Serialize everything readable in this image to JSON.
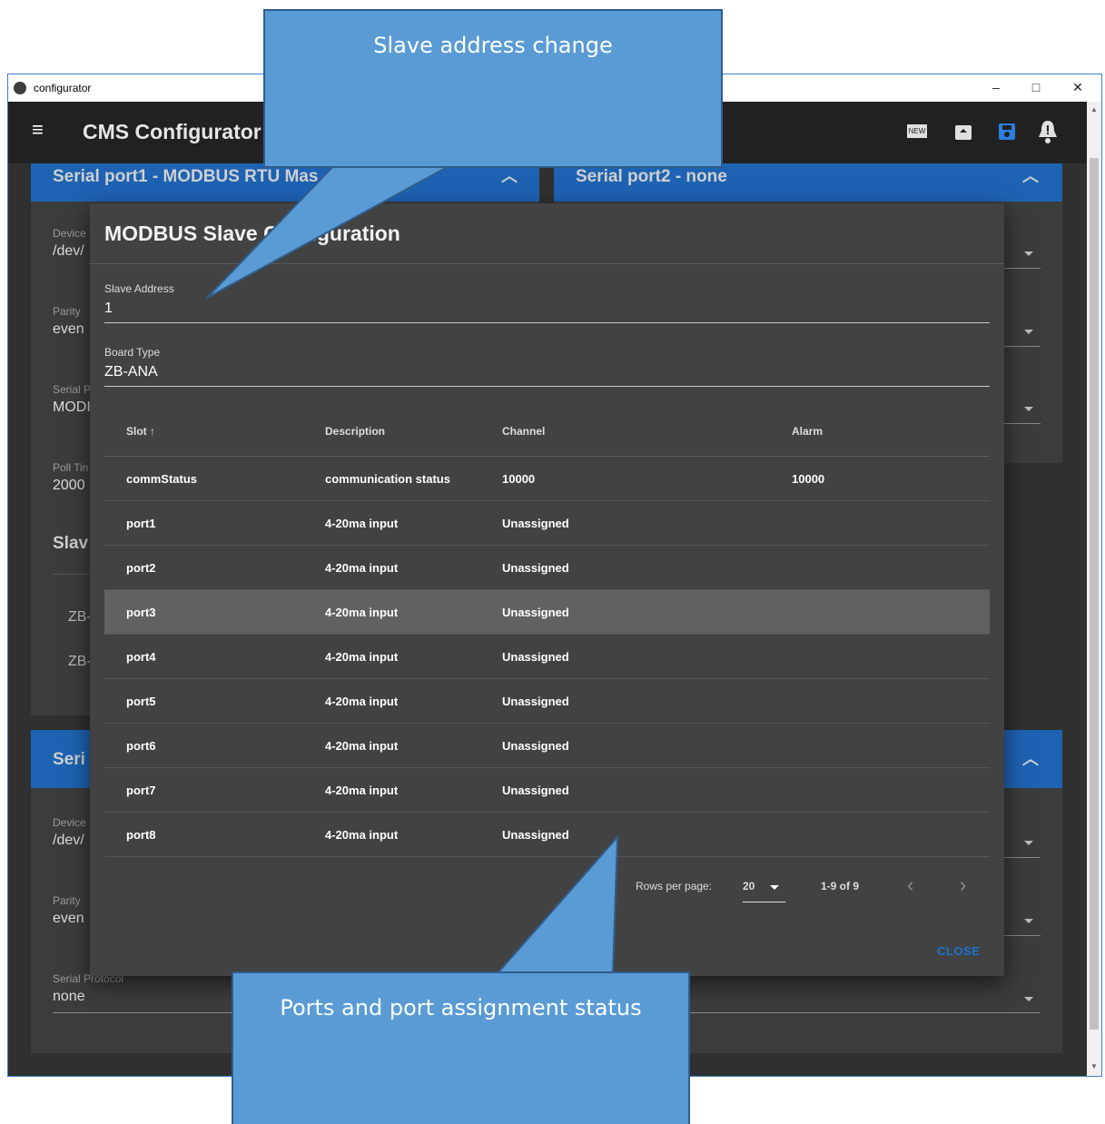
{
  "window": {
    "title": "configurator",
    "controls": {
      "minimize": "–",
      "maximize": "□",
      "close": "✕"
    }
  },
  "appbar": {
    "menu_icon": "≡",
    "title": "CMS Configurator",
    "actions": [
      {
        "icon": "new-icon",
        "label": "NEW"
      },
      {
        "icon": "archive-icon"
      },
      {
        "icon": "save-icon"
      },
      {
        "icon": "bell-alert-icon"
      }
    ]
  },
  "background": {
    "port1_header": "Serial port1 - MODBUS RTU Mas",
    "port2_header": "Serial port2 - none",
    "port1_fields": [
      {
        "label": "Device",
        "value": "/dev/"
      },
      {
        "label": "Parity",
        "value": "even"
      },
      {
        "label": "Serial P",
        "value": "MODI"
      },
      {
        "label": "Poll Tin",
        "value": "2000"
      }
    ],
    "slaves_heading": "Slav",
    "slave_items": [
      "ZB-",
      "ZB-"
    ],
    "port3_header": "Seri",
    "port3_fields": [
      {
        "label": "Device",
        "value": "/dev/"
      },
      {
        "label": "Parity",
        "value": "even"
      },
      {
        "label": "Serial Protocol",
        "value": "none"
      }
    ]
  },
  "dialog": {
    "title": "MODBUS Slave Configuration",
    "slave_address": {
      "label": "Slave Address",
      "value": "1"
    },
    "board_type": {
      "label": "Board Type",
      "value": "ZB-ANA"
    },
    "table": {
      "headers": [
        "Slot ↑",
        "Description",
        "Channel",
        "Alarm"
      ],
      "rows": [
        [
          "commStatus",
          "communication status",
          "10000",
          "10000"
        ],
        [
          "port1",
          "4-20ma input",
          "Unassigned",
          ""
        ],
        [
          "port2",
          "4-20ma input",
          "Unassigned",
          ""
        ],
        [
          "port3",
          "4-20ma input",
          "Unassigned",
          ""
        ],
        [
          "port4",
          "4-20ma input",
          "Unassigned",
          ""
        ],
        [
          "port5",
          "4-20ma input",
          "Unassigned",
          ""
        ],
        [
          "port6",
          "4-20ma input",
          "Unassigned",
          ""
        ],
        [
          "port7",
          "4-20ma input",
          "Unassigned",
          ""
        ],
        [
          "port8",
          "4-20ma input",
          "Unassigned",
          ""
        ]
      ],
      "selected_row": 3
    },
    "pagination": {
      "rows_per_page_label": "Rows per page:",
      "rows_per_page_value": "20",
      "range": "1-9 of 9",
      "prev": "‹",
      "next": "›"
    },
    "close_label": "CLOSE"
  },
  "callouts": {
    "top": "Slave address change",
    "bottom": "Ports and port assignment status"
  },
  "colors": {
    "accent": "#1e63b3",
    "callout": "#5b9bd5",
    "dialog_bg": "#424242",
    "selected_row": "#616161"
  }
}
